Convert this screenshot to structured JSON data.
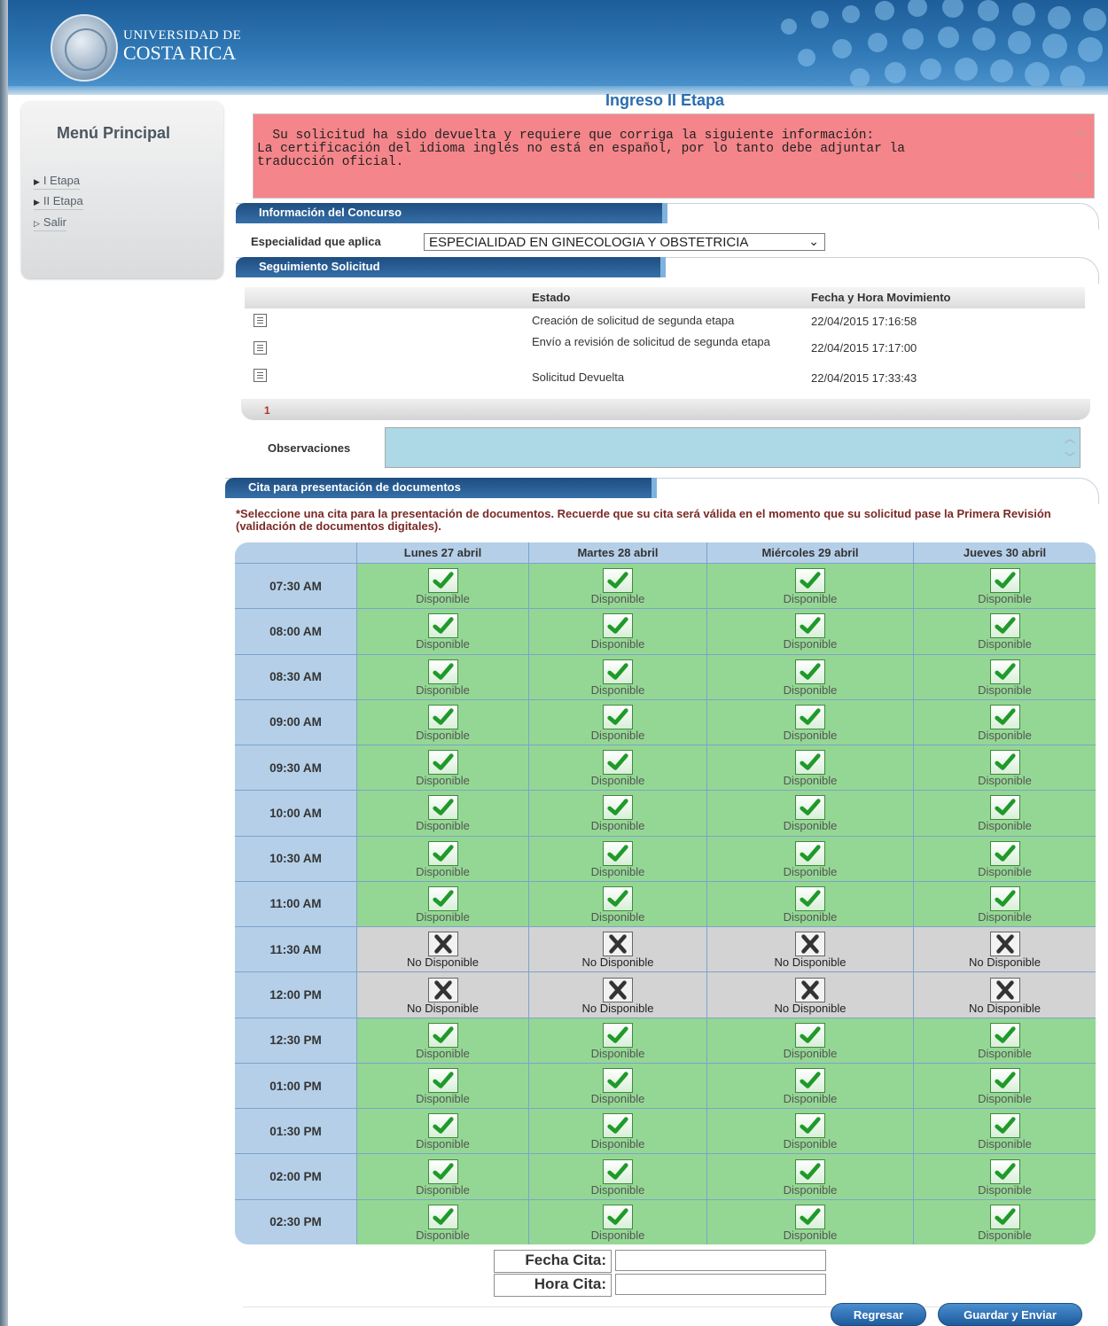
{
  "header": {
    "university_line1": "UNIVERSIDAD DE",
    "university_line2": "COSTA RICA"
  },
  "sidebar": {
    "title": "Menú Principal",
    "items": [
      {
        "label": "I Etapa"
      },
      {
        "label": "II Etapa"
      },
      {
        "label": "Salir"
      }
    ]
  },
  "page": {
    "title": "Ingreso II Etapa",
    "alert_message": "Su solicitud ha sido devuelta y requiere que corriga la siguiente información:\nLa certificación del idioma inglés no está en español, por lo tanto debe adjuntar la\ntraducción oficial."
  },
  "concurso": {
    "section_title": "Información del Concurso",
    "especialidad_label": "Especialidad que aplica",
    "especialidad_value": "ESPECIALIDAD EN GINECOLOGIA Y OBSTETRICIA"
  },
  "seguimiento": {
    "section_title": "Seguimiento Solicitud",
    "columns": {
      "estado": "Estado",
      "fecha": "Fecha y Hora Movimiento"
    },
    "rows": [
      {
        "estado": "Creación de solicitud de segunda etapa",
        "fecha": "22/04/2015 17:16:58"
      },
      {
        "estado": "Envío a revisión de solicitud de segunda etapa",
        "fecha": "22/04/2015 17:17:00"
      },
      {
        "estado": "Solicitud Devuelta",
        "fecha": "22/04/2015 17:33:43"
      }
    ],
    "page_number": "1",
    "observaciones_label": "Observaciones",
    "observaciones_value": ""
  },
  "cita": {
    "section_title": "Cita para presentación de documentos",
    "note": "*Seleccione una cita para la presentación de documentos. Recuerde que su cita será válida en el momento que su solicitud pase la Primera Revisión (validación de documentos digitales).",
    "days": [
      "Lunes 27 abril",
      "Martes 28 abril",
      "Miércoles 29 abril",
      "Jueves 30 abril"
    ],
    "available_label": "Disponible",
    "unavailable_label": "No Disponible",
    "slots": [
      {
        "time": "07:30 AM",
        "available": true
      },
      {
        "time": "08:00 AM",
        "available": true
      },
      {
        "time": "08:30 AM",
        "available": true
      },
      {
        "time": "09:00 AM",
        "available": true
      },
      {
        "time": "09:30 AM",
        "available": true
      },
      {
        "time": "10:00 AM",
        "available": true
      },
      {
        "time": "10:30 AM",
        "available": true
      },
      {
        "time": "11:00 AM",
        "available": true
      },
      {
        "time": "11:30 AM",
        "available": false
      },
      {
        "time": "12:00 PM",
        "available": false
      },
      {
        "time": "12:30 PM",
        "available": true
      },
      {
        "time": "01:00 PM",
        "available": true
      },
      {
        "time": "01:30 PM",
        "available": true
      },
      {
        "time": "02:00 PM",
        "available": true
      },
      {
        "time": "02:30 PM",
        "available": true
      }
    ],
    "fecha_label": "Fecha Cita:",
    "fecha_value": "",
    "hora_label": "Hora Cita:",
    "hora_value": ""
  },
  "actions": {
    "back_label": "Regresar",
    "save_label": "Guardar y Enviar"
  },
  "colors": {
    "available": "#94d794",
    "unavailable": "#d3d3d3",
    "alert_bg": "#f4858a",
    "observaciones_bg": "#add8e6",
    "title": "#2a6db0"
  },
  "icons": {
    "available": "checkmark-icon",
    "unavailable": "x-icon",
    "row_detail": "document-icon"
  }
}
